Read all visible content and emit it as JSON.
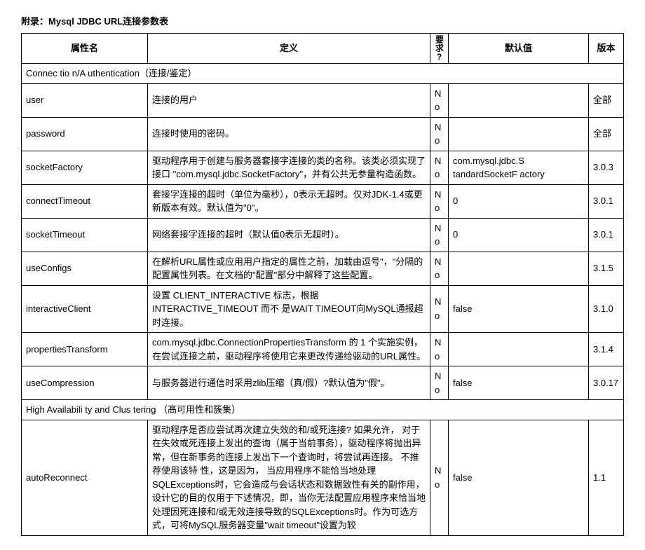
{
  "title": "附录：Mysql JDBC URL连接参数表",
  "headers": {
    "prop": "属性名",
    "def": "定义",
    "req": "要求?",
    "default": "默认值",
    "ver": "版本"
  },
  "sections": [
    {
      "label": "Connec tio n/A uthentication（连接/鉴定）",
      "rows": [
        {
          "prop": "user",
          "def": "连接的用户",
          "req": "No",
          "default": "",
          "ver": "全部"
        },
        {
          "prop": "password",
          "def": "连接时使用的密码。",
          "req": "No",
          "default": "",
          "ver": "全部"
        },
        {
          "prop": "socketFactory",
          "def": "驱动程序用于创建与服务器套接字连接的类的名称。该类必须实现了接口 \"com.mysql.jdbc.SocketFactory\"，并有公共无参量构造函数。",
          "req": "No",
          "default": "com.mysql.jdbc.S tandardSocketF actory",
          "ver": "3.0.3"
        },
        {
          "prop": "connectTimeout",
          "def": "套接字连接的超时（单位为毫秒），0表示无超时。仅对JDK-1.4或更新版本有效。默认值为\"0\"。",
          "req": "No",
          "default": "0",
          "ver": "3.0.1"
        },
        {
          "prop": "socketTimeout",
          "def": "网络套接字连接的超时（默认值0表示无超时）。",
          "req": "No",
          "default": "0",
          "ver": "3.0.1"
        },
        {
          "prop": "useConfigs",
          "def": "在解析URL属性或应用用户指定的属性之前，加载由逗号\"，\"分隔的配置属性列表。在文档的\"配置\"部分中解释了这些配置。",
          "req": "No",
          "default": "",
          "ver": "3.1.5"
        },
        {
          "prop": "interactiveClient",
          "def": "设置 CLIENT_INTERACTIVE 标志，根据 INTERACTIVE_TIMEOUT 而不 是WAIT TIMEOUT向MySQL通报超时连接。",
          "req": "No",
          "default": "false",
          "ver": "3.1.0"
        },
        {
          "prop": "propertiesTransform",
          "def": "com.mysql.jdbc.ConnectionPropertiesTransform 的 1 个实施实例，在尝试连接之前，驱动程序将使用它来更改传递给驱动的URL属性。",
          "req": "No",
          "default": "",
          "ver": "3.1.4"
        },
        {
          "prop": "useCompression",
          "def": "与服务器进行通信时采用zlib压缩（真/假）?默认值为\"假\"。",
          "req": "No",
          "default": "false",
          "ver": "3.0.17"
        }
      ]
    },
    {
      "label": "High Availabili ty and Clus tering （髙可用性和簇集）",
      "rows": [
        {
          "prop": "autoReconnect",
          "def": "驱动程序是否应尝试再次建立失效的和/或死连接? 如果允许， 对于在失效或死连接上发出的查询（属于当前事务），驱动程序将抛出异常，但在新事务的连接上发出下一个查询时，将尝试再连接。 不推荐使用该特 性，这是因为， 当应用程序不能恰当地处理SQLExceptions时，它会造成与会话状态和数据致性有关的副作用，设计它的目的仅用于下述情况，即，当你无法配置应用程序来恰当地处理因死连接和/或无效连接导致的SQLExceptions时。作为可选方式，可将MySQL服务器变量\"wait timeout\"设置为较",
          "req": "No",
          "default": "false",
          "ver": "1.1"
        }
      ]
    }
  ]
}
